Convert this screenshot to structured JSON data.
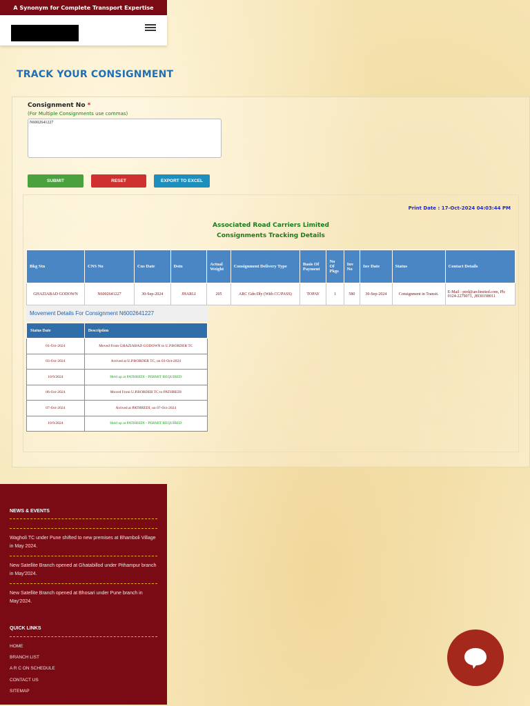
{
  "header": {
    "tagline": "A Synonym for Complete Transport Expertise"
  },
  "page_title": "TRACK YOUR CONSIGNMENT",
  "form": {
    "label": "Consignment No",
    "required_mark": "*",
    "hint": "(For Multiple Consignments use commas)",
    "value": "N6002641227",
    "submit_label": "SUBMIT",
    "reset_label": "RESET",
    "export_label": "EXPORT TO EXCEL"
  },
  "results": {
    "print_date": "Print Date : 17-Oct-2024 04:03:44 PM",
    "org_name": "Associated Road Carriers Limited",
    "subtitle": "Consignments Tracking Details",
    "columns": [
      "Bkg Stn",
      "CNS No",
      "Cns Date",
      "Dstn",
      "Actual Weight",
      "Consignment Delivery Type",
      "Basis Of Payment",
      "No Of Pkgs",
      "Inv No",
      "Inv Date",
      "Status",
      "Contact Details"
    ],
    "rows": [
      [
        "GHAZIABAD GODOWN",
        "N6002641227",
        "30-Sep-2024",
        "JHARLI",
        "205",
        "ARC Gdn Dly (With CC/PASS)",
        "TOPAY",
        "1",
        "580",
        "30-Sep-2024",
        "Consignment in Transit.",
        "E-Mail : ptrd@arclimited.com, Ph: 0124-2279071, ,8930198011"
      ]
    ]
  },
  "movement": {
    "title": "Movement Details For Consignment N6002641227",
    "columns": [
      "Status Date",
      "Description"
    ],
    "rows": [
      [
        "01-Oct-2024",
        "Moved From GHAZIABAD GODOWN to U.P.BORDER TC"
      ],
      [
        "03-Oct-2024",
        "Arrived at U.P.BORDER TC, on 03-Oct-2024"
      ],
      [
        "10/9/2024",
        "Held up at PATHREDI - PERMIT REQUIRED"
      ],
      [
        "06-Oct-2024",
        "Moved From U.P.BORDER TC to PATHREDI"
      ],
      [
        "07-Oct-2024",
        "Arrived at PATHREDI, on 07-Oct-2024"
      ],
      [
        "10/9/2024",
        "Held up at PATHREDI - PERMIT REQUIRED"
      ]
    ]
  },
  "footer": {
    "news_heading": "NEWS & EVENTS",
    "news": [
      "Wagholi TC under Pune shifted to new premises at Bhamboli Village in May 2024.",
      "New Satellite Branch opened at Ghatabillod under Pithampur branch in May'2024.",
      "New Satellite Branch opened at Bhosari under Pune branch in May'2024."
    ],
    "links_heading": "QUICK LINKS",
    "links": [
      "HOME",
      "BRANCH LIST",
      "A R C ON SCHEDULE",
      "CONTACT US",
      "SITEMAP"
    ]
  },
  "colors": {
    "brand_maroon": "#7a0a14",
    "title_blue": "#1f6fb5",
    "table_header_blue": "#4a86c4",
    "submit_green": "#4aa13d",
    "reset_red": "#cf3131",
    "export_blue": "#1e8ebd"
  },
  "icons": {
    "menu": "hamburger-icon",
    "chat": "chat-bubble-icon"
  }
}
